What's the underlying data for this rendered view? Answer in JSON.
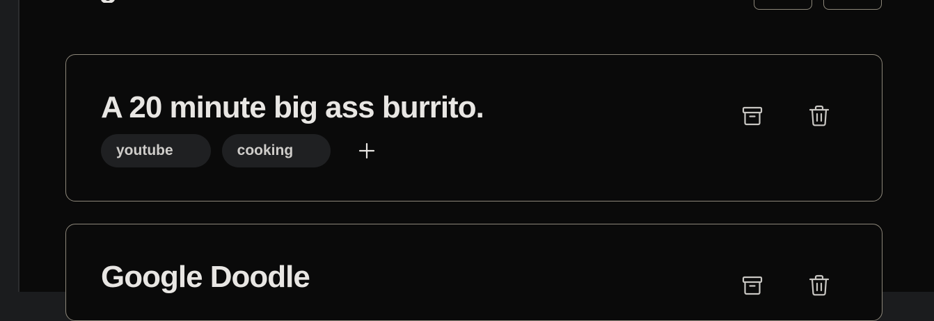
{
  "header": {
    "title_fragment": "g"
  },
  "cards": [
    {
      "title": "A 20 minute big ass burrito.",
      "tags": [
        "youtube",
        "cooking"
      ],
      "icons": [
        "archive-icon",
        "trash-icon",
        "plus-icon"
      ]
    },
    {
      "title": "Google Doodle",
      "icons": [
        "archive-icon",
        "trash-icon"
      ]
    }
  ],
  "colors": {
    "background": "#0a0a0a",
    "sidebar": "#1b1c1e",
    "card_border": "#8d877a",
    "tag_background": "#1f2022",
    "text": "#e8e6e3"
  }
}
